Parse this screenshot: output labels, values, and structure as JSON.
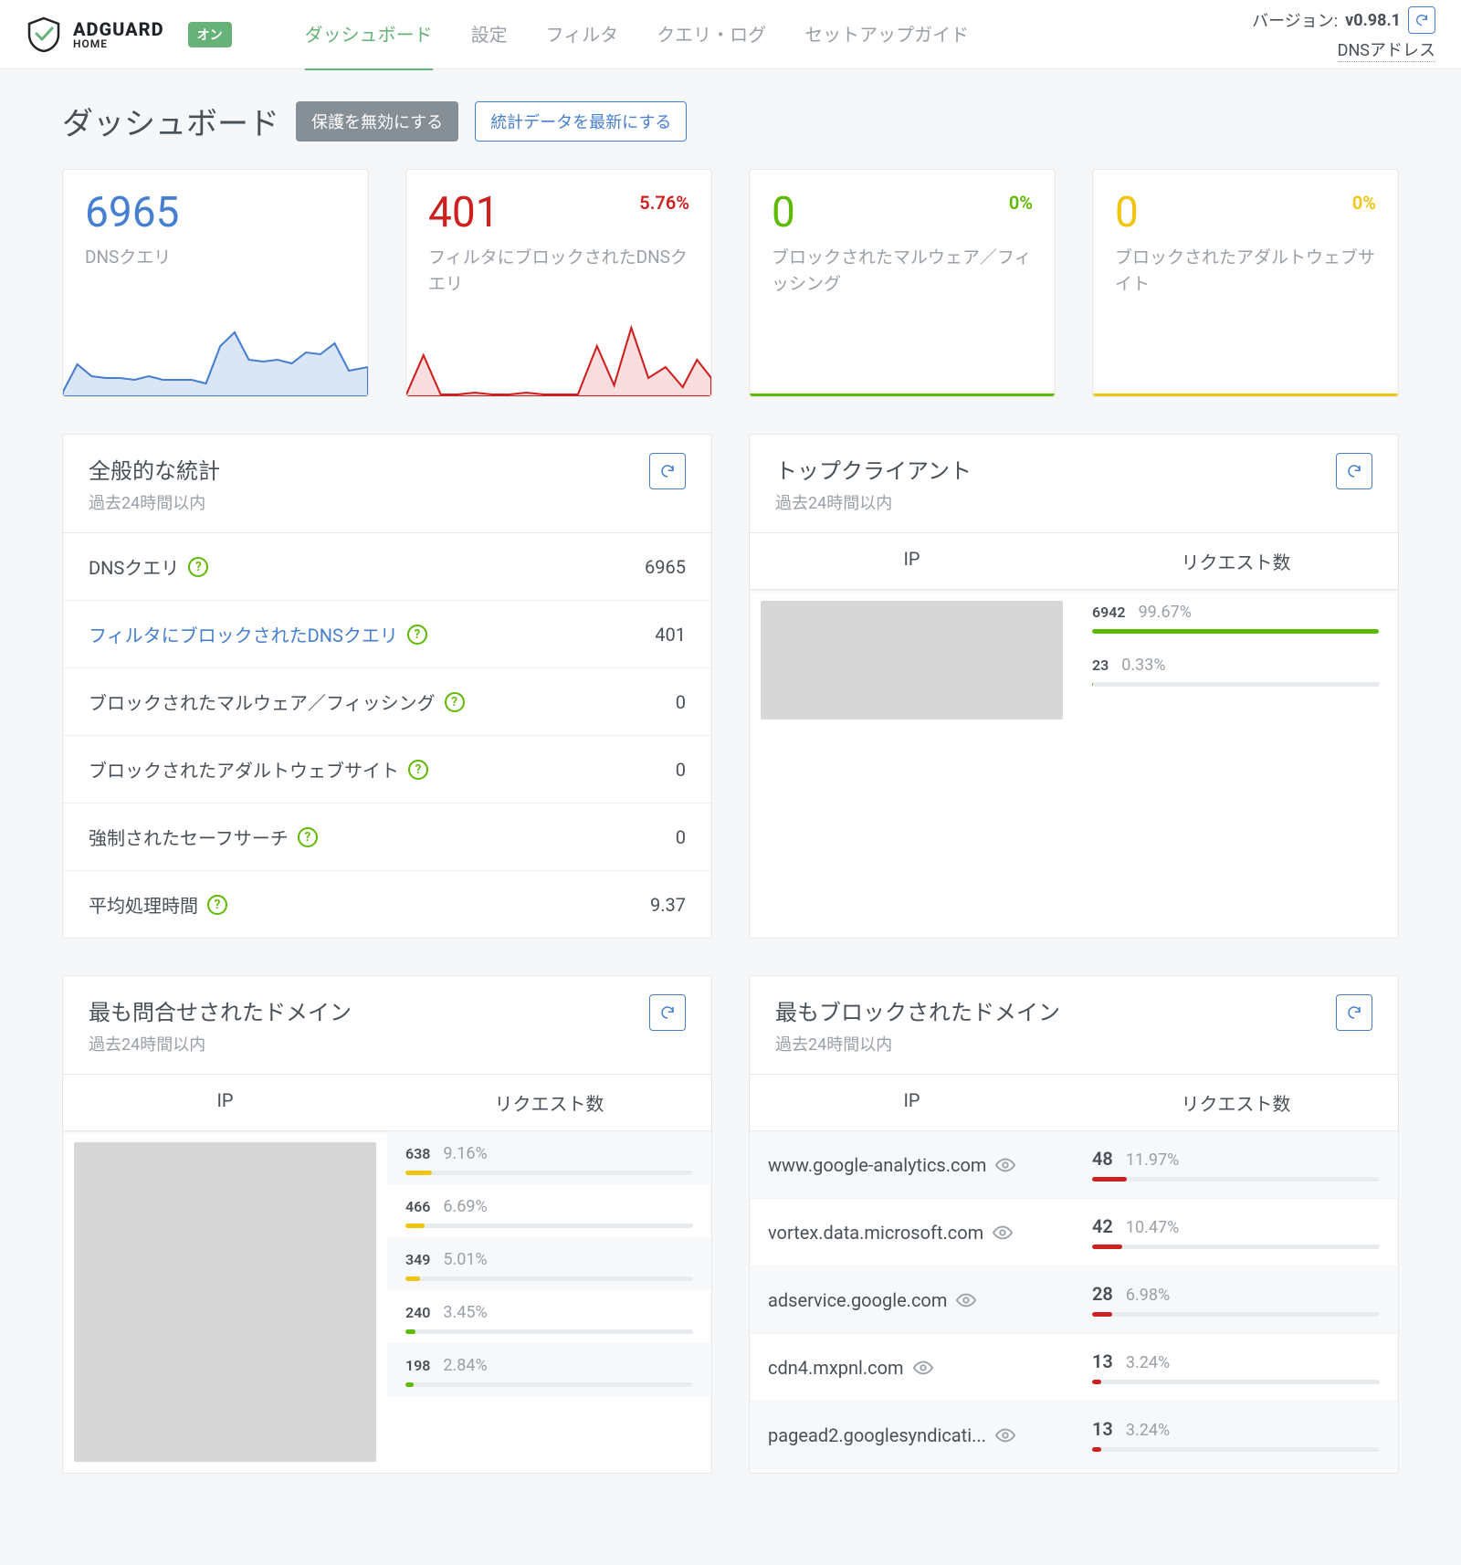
{
  "header": {
    "brand": "ADGUARD",
    "sub": "HOME",
    "badge": "オン",
    "nav": [
      "ダッシュボード",
      "設定",
      "フィルタ",
      "クエリ・ログ",
      "セットアップガイド"
    ],
    "version_label": "バージョン:",
    "version": "v0.98.1",
    "dns_address": "DNSアドレス"
  },
  "page": {
    "title": "ダッシュボード",
    "btn_disable": "保護を無効にする",
    "btn_refresh": "統計データを最新にする"
  },
  "stats": {
    "dns": {
      "value": "6965",
      "label": "DNSクエリ"
    },
    "blocked": {
      "value": "401",
      "label": "フィルタにブロックされたDNSクエリ",
      "pct": "5.76%"
    },
    "malware": {
      "value": "0",
      "label": "ブロックされたマルウェア／フィッシング",
      "pct": "0%"
    },
    "adult": {
      "value": "0",
      "label": "ブロックされたアダルトウェブサイト",
      "pct": "0%"
    }
  },
  "general": {
    "title": "全般的な統計",
    "sub": "過去24時間以内",
    "rows": [
      {
        "label": "DNSクエリ",
        "value": "6965",
        "blue": false
      },
      {
        "label": "フィルタにブロックされたDNSクエリ",
        "value": "401",
        "blue": true
      },
      {
        "label": "ブロックされたマルウェア／フィッシング",
        "value": "0",
        "blue": false
      },
      {
        "label": "ブロックされたアダルトウェブサイト",
        "value": "0",
        "blue": false
      },
      {
        "label": "強制されたセーフサーチ",
        "value": "0",
        "blue": false
      },
      {
        "label": "平均処理時間",
        "value": "9.37",
        "blue": false
      }
    ]
  },
  "top_clients": {
    "title": "トップクライアント",
    "sub": "過去24時間以内",
    "col_ip": "IP",
    "col_req": "リクエスト数",
    "rows": [
      {
        "count": "6942",
        "pct": "99.67%",
        "bar": 99.67,
        "color": "#5eba00"
      },
      {
        "count": "23",
        "pct": "0.33%",
        "bar": 0.33,
        "color": "#5eba00"
      }
    ]
  },
  "queried": {
    "title": "最も問合せされたドメイン",
    "sub": "過去24時間以内",
    "col_ip": "IP",
    "col_req": "リクエスト数",
    "rows": [
      {
        "count": "638",
        "pct": "9.16%",
        "bar": 9.16,
        "color": "#f1c40f"
      },
      {
        "count": "466",
        "pct": "6.69%",
        "bar": 6.69,
        "color": "#f1c40f"
      },
      {
        "count": "349",
        "pct": "5.01%",
        "bar": 5.01,
        "color": "#f1c40f"
      },
      {
        "count": "240",
        "pct": "3.45%",
        "bar": 3.45,
        "color": "#5eba00"
      },
      {
        "count": "198",
        "pct": "2.84%",
        "bar": 2.84,
        "color": "#5eba00"
      }
    ]
  },
  "blocked_domains": {
    "title": "最もブロックされたドメイン",
    "sub": "過去24時間以内",
    "col_ip": "IP",
    "col_req": "リクエスト数",
    "rows": [
      {
        "domain": "www.google-analytics.com",
        "count": "48",
        "pct": "11.97%",
        "bar": 11.97,
        "color": "#cd201f"
      },
      {
        "domain": "vortex.data.microsoft.com",
        "count": "42",
        "pct": "10.47%",
        "bar": 10.47,
        "color": "#cd201f"
      },
      {
        "domain": "adservice.google.com",
        "count": "28",
        "pct": "6.98%",
        "bar": 6.98,
        "color": "#cd201f"
      },
      {
        "domain": "cdn4.mxpnl.com",
        "count": "13",
        "pct": "3.24%",
        "bar": 3.24,
        "color": "#cd201f"
      },
      {
        "domain": "pagead2.googlesyndicati...",
        "count": "13",
        "pct": "3.24%",
        "bar": 3.24,
        "color": "#cd201f"
      }
    ]
  },
  "chart_data": [
    {
      "type": "area",
      "title": "DNSクエリ sparkline",
      "values": [
        5,
        30,
        18,
        16,
        16,
        14,
        18,
        14,
        14,
        14,
        10,
        50,
        70,
        42,
        40,
        42,
        38,
        50,
        48,
        60,
        30,
        35
      ],
      "color": "#467fcf"
    },
    {
      "type": "area",
      "title": "フィルタにブロックされた sparkline",
      "values": [
        0,
        40,
        0,
        0,
        2,
        0,
        0,
        2,
        0,
        0,
        0,
        0,
        55,
        10,
        80,
        20,
        32,
        10,
        40
      ],
      "color": "#cd201f"
    },
    {
      "type": "line",
      "title": "マルウェア sparkline",
      "values": [
        0,
        0,
        0,
        0,
        0,
        0
      ],
      "color": "#5eba00"
    },
    {
      "type": "line",
      "title": "アダルト sparkline",
      "values": [
        0,
        0,
        0,
        0,
        0,
        0
      ],
      "color": "#f1c40f"
    }
  ]
}
